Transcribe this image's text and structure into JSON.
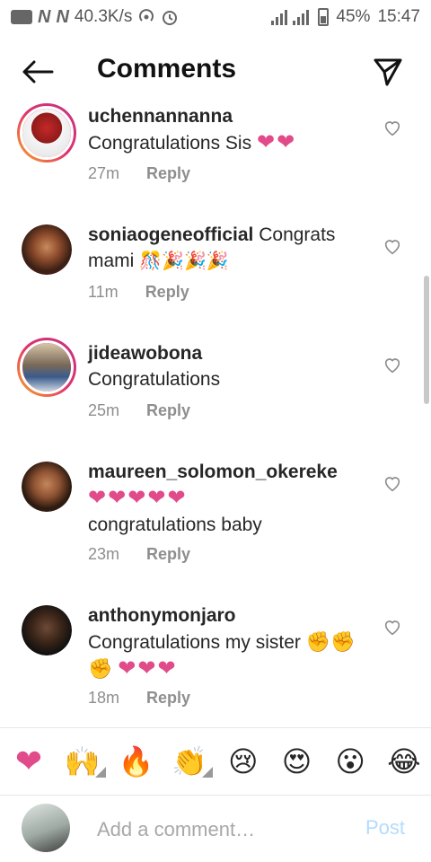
{
  "status_bar": {
    "speed": "40.3K/s",
    "battery": "45%",
    "time": "15:47"
  },
  "header": {
    "title": "Comments"
  },
  "comments": [
    {
      "username": "uchennannanna",
      "text": "Congratulations Sis",
      "emoji": "❤❤",
      "time": "27m",
      "reply": "Reply"
    },
    {
      "username": "soniaogeneofficial",
      "text": "Congrats mami",
      "emoji": "🎊🎉🎉🎉",
      "time": "11m",
      "reply": "Reply"
    },
    {
      "username": "jideawobona",
      "text": "Congratulations",
      "emoji": "",
      "time": "25m",
      "reply": "Reply"
    },
    {
      "username": "maureen_solomon_okereke",
      "text": "congratulations baby",
      "emoji": "❤❤❤❤❤",
      "time": "23m",
      "reply": "Reply"
    },
    {
      "username": "anthonymonjaro",
      "text": "Congratulations my sister",
      "emoji_fists": "✊✊✊",
      "emoji_hearts": "❤❤❤",
      "time": "18m",
      "reply": "Reply"
    }
  ],
  "emoji_bar": {
    "heart": "❤",
    "raised_hands": "🙌",
    "fire": "🔥",
    "clap": "👏",
    "cry": "😢",
    "heart_eyes": "😍",
    "wow": "😮",
    "laugh": "😂"
  },
  "input": {
    "placeholder": "Add a comment…",
    "post_label": "Post"
  },
  "colors": {
    "heart": "#e24b8a",
    "post_disabled": "#b3dbff",
    "meta": "#8e8e8e"
  }
}
